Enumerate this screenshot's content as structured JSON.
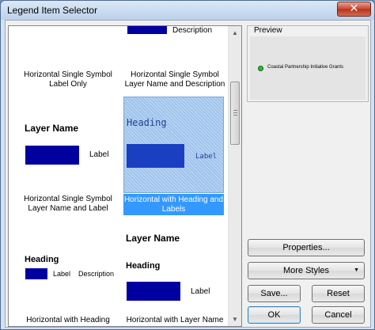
{
  "window": {
    "title": "Legend Item Selector",
    "close_glyph": "✕"
  },
  "gallery": {
    "items": [
      {
        "top_desc_text": "Description",
        "label": "Horizontal Single Symbol\nLabel Only"
      },
      {
        "label": "Horizontal Single Symbol\nLayer Name and Description"
      },
      {
        "layer_name": "Layer Name",
        "patch_label": "Label",
        "label": "Horizontal Single Symbol\nLayer Name and Label"
      },
      {
        "heading": "Heading",
        "patch_label": "Label",
        "label": "Horizontal with Heading and\nLabels",
        "selected": true
      },
      {
        "heading": "Heading",
        "patch_label": "Label",
        "patch_desc": "Description",
        "label": "Horizontal with Heading"
      },
      {
        "layer_name": "Layer Name",
        "heading": "Heading",
        "patch_label": "Label",
        "label": "Horizontal with Layer Name"
      }
    ]
  },
  "preview": {
    "title": "Preview",
    "legend_text": "Coastal Partnership Initiative Grants"
  },
  "buttons": {
    "properties": "Properties...",
    "more_styles": "More Styles",
    "save": "Save...",
    "reset": "Reset",
    "ok": "OK",
    "cancel": "Cancel"
  },
  "colors": {
    "patch": "#0000a0",
    "selection": "#3399ff",
    "preview_symbol": "#21c321"
  },
  "icons": {
    "scroll_up": "scroll-up-arrow-icon",
    "scroll_down": "scroll-down-arrow-icon",
    "dropdown": "chevron-down-icon"
  }
}
